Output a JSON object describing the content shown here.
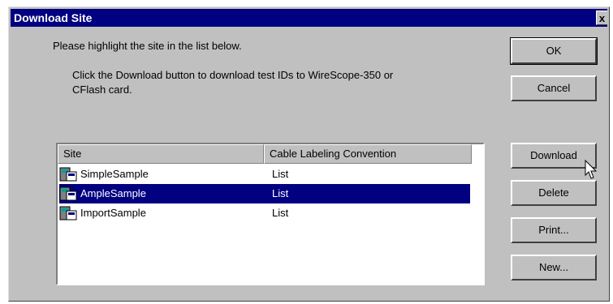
{
  "window": {
    "title": "Download Site",
    "close_label": "x"
  },
  "instructions": {
    "line1": "Please highlight the site in the list below.",
    "line2": "Click the Download button to download test IDs to WireScope-350 or",
    "line3": "CFlash card."
  },
  "buttons": {
    "ok": "OK",
    "cancel": "Cancel",
    "download": "Download",
    "delete": "Delete",
    "print": "Print...",
    "new": "New..."
  },
  "list": {
    "headers": [
      "Site",
      "Cable Labeling Convention"
    ],
    "rows": [
      {
        "site": "SimpleSample",
        "convention": "List",
        "selected": false,
        "icon": "site-database-icon"
      },
      {
        "site": "AmpleSample",
        "convention": "List",
        "selected": true,
        "icon": "site-database-icon"
      },
      {
        "site": "ImportSample",
        "convention": "List",
        "selected": false,
        "icon": "site-database-icon"
      }
    ]
  },
  "colors": {
    "titlebar": "#000080",
    "selection": "#000080",
    "face": "#c0c0c0"
  }
}
